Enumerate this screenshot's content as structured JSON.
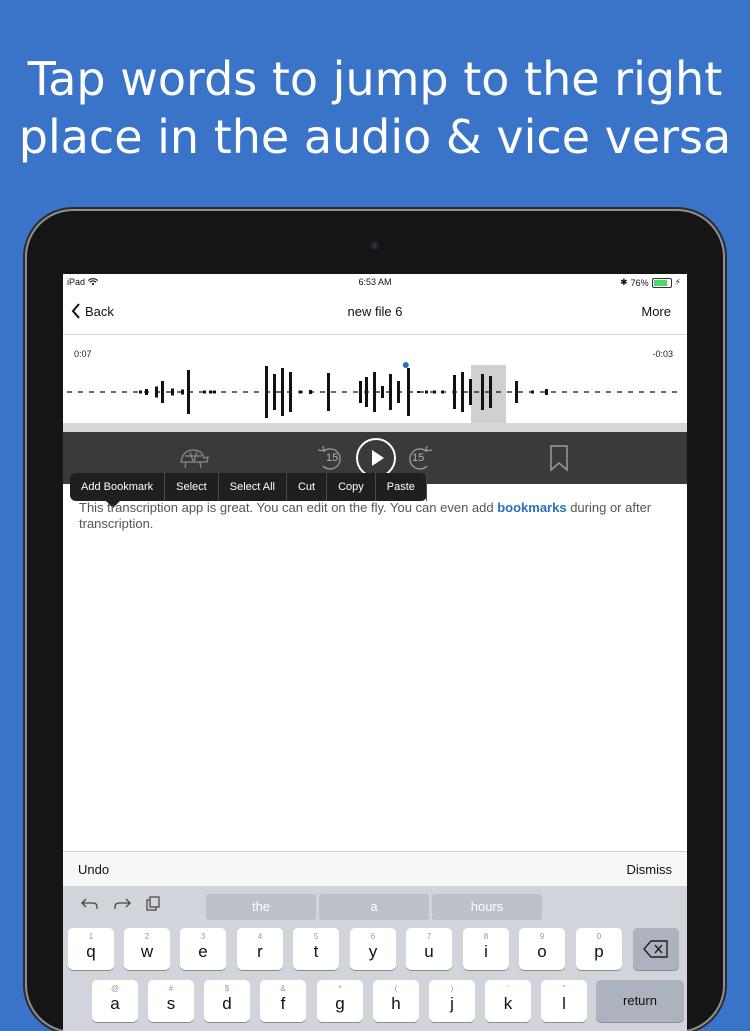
{
  "headline": {
    "line1": "Tap words to jump to the right",
    "line2": "place in the audio & vice versa"
  },
  "status_bar": {
    "device": "iPad",
    "time": "6:53 AM",
    "battery": "76%"
  },
  "nav": {
    "back_label": "Back",
    "title": "new file 6",
    "more_label": "More"
  },
  "waveform": {
    "elapsed": "0:07",
    "remaining": "-0:03",
    "playhead_fraction": 0.55
  },
  "controls": {
    "skip_back_seconds": "15",
    "skip_forward_seconds": "15",
    "icons": [
      "turtle-speed-icon",
      "skip-back-icon",
      "play-icon",
      "skip-forward-icon",
      "bookmark-icon"
    ]
  },
  "context_menu": {
    "items": [
      "Add Bookmark",
      "Select",
      "Select All",
      "Cut",
      "Copy",
      "Paste"
    ]
  },
  "transcript": {
    "before": "This transcription app is great. You can edit on the fly. You can even add ",
    "bookmark_word": "bookmarks",
    "after": " during or after transcription."
  },
  "keyboard_accessory": {
    "undo_label": "Undo",
    "dismiss_label": "Dismiss"
  },
  "keyboard": {
    "suggestions": [
      "the",
      "a",
      "hours"
    ],
    "row1": [
      {
        "alt": "1",
        "main": "q"
      },
      {
        "alt": "2",
        "main": "w"
      },
      {
        "alt": "3",
        "main": "e"
      },
      {
        "alt": "4",
        "main": "r"
      },
      {
        "alt": "5",
        "main": "t"
      },
      {
        "alt": "6",
        "main": "y"
      },
      {
        "alt": "7",
        "main": "u"
      },
      {
        "alt": "8",
        "main": "i"
      },
      {
        "alt": "9",
        "main": "o"
      },
      {
        "alt": "0",
        "main": "p"
      }
    ],
    "row2": [
      {
        "alt": "@",
        "main": "a"
      },
      {
        "alt": "#",
        "main": "s"
      },
      {
        "alt": "$",
        "main": "d"
      },
      {
        "alt": "&",
        "main": "f"
      },
      {
        "alt": "*",
        "main": "g"
      },
      {
        "alt": "(",
        "main": "h"
      },
      {
        "alt": ")",
        "main": "j"
      },
      {
        "alt": "'",
        "main": "k"
      },
      {
        "alt": "\"",
        "main": "l"
      }
    ],
    "return_label": "return"
  },
  "colors": {
    "background": "#3a74c9",
    "controls_bar": "#3a3a3c",
    "bookmark_link": "#2a6fbf",
    "playhead": "#2a6fbf"
  }
}
